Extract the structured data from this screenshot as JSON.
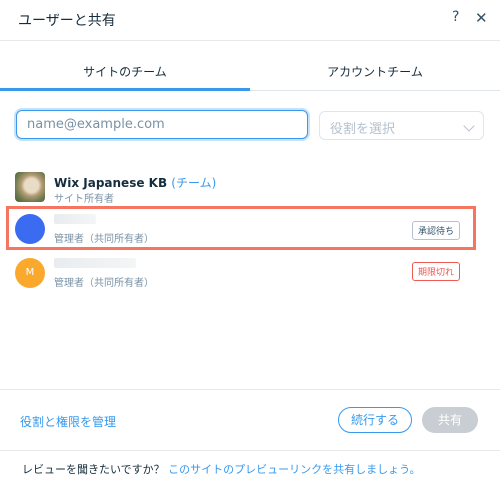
{
  "header": {
    "title": "ユーザーと共有",
    "help": "?",
    "close": "✕"
  },
  "tabs": [
    {
      "label": "サイトのチーム",
      "active": true
    },
    {
      "label": "アカウントチーム",
      "active": false
    }
  ],
  "invite": {
    "email_value": "",
    "email_placeholder": "name@example.com",
    "role_placeholder": "役割を選択"
  },
  "members": [
    {
      "name": "Wix Japanese KB",
      "team_tag": "(チーム)",
      "role": "サイト所有者",
      "avatar": "photo"
    },
    {
      "role": "管理者（共同所有者）",
      "avatar": "blue-circle",
      "status": "承認待ち"
    },
    {
      "initial": "M",
      "role": "管理者（共同所有者）",
      "avatar": "orange-circle",
      "status": "期限切れ"
    }
  ],
  "actions": {
    "manage_roles": "役割と権限を管理",
    "continue": "続行する",
    "share": "共有"
  },
  "footer": {
    "text": "レビューを聞きたいですか？ ",
    "link": "このサイトのプレビューリンクを共有しましょう。"
  },
  "colors": {
    "accent": "#3899ec",
    "highlight": "#f47560",
    "expired": "#ee5951"
  }
}
